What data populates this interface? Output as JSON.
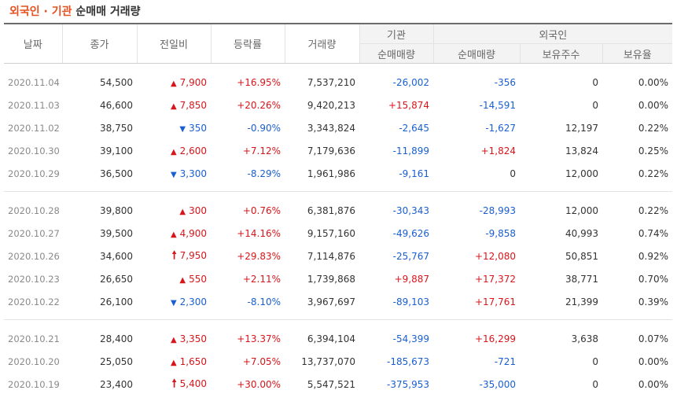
{
  "title": {
    "part1": "외국인",
    "sep": " · ",
    "part2": "기관",
    "part3": "순매매 거래량"
  },
  "colors": {
    "up": "#d8151b",
    "down": "#1a5fd1",
    "title_accent": "#e6501e"
  },
  "columns": {
    "date": "날짜",
    "close": "종가",
    "change": "전일비",
    "rate": "등락률",
    "volume": "거래량",
    "inst_group": "기관",
    "inst_net": "순매매량",
    "foreign_group": "외국인",
    "foreign_net": "순매매량",
    "foreign_hold": "보유주수",
    "foreign_ratio": "보유율"
  },
  "groups": [
    [
      {
        "date": "2020.11.04",
        "close": "54,500",
        "dir": "up",
        "arrow": "▲",
        "change": "7,900",
        "rate": "+16.95%",
        "volume": "7,537,210",
        "inst": "-26,002",
        "foreign": "-356",
        "hold": "0",
        "ratio": "0.00%"
      },
      {
        "date": "2020.11.03",
        "close": "46,600",
        "dir": "up",
        "arrow": "▲",
        "change": "7,850",
        "rate": "+20.26%",
        "volume": "9,420,213",
        "inst": "+15,874",
        "foreign": "-14,591",
        "hold": "0",
        "ratio": "0.00%"
      },
      {
        "date": "2020.11.02",
        "close": "38,750",
        "dir": "down",
        "arrow": "▼",
        "change": "350",
        "rate": "-0.90%",
        "volume": "3,343,824",
        "inst": "-2,645",
        "foreign": "-1,627",
        "hold": "12,197",
        "ratio": "0.22%"
      },
      {
        "date": "2020.10.30",
        "close": "39,100",
        "dir": "up",
        "arrow": "▲",
        "change": "2,600",
        "rate": "+7.12%",
        "volume": "7,179,636",
        "inst": "-11,899",
        "foreign": "+1,824",
        "hold": "13,824",
        "ratio": "0.25%"
      },
      {
        "date": "2020.10.29",
        "close": "36,500",
        "dir": "down",
        "arrow": "▼",
        "change": "3,300",
        "rate": "-8.29%",
        "volume": "1,961,986",
        "inst": "-9,161",
        "foreign": "0",
        "hold": "12,000",
        "ratio": "0.22%"
      }
    ],
    [
      {
        "date": "2020.10.28",
        "close": "39,800",
        "dir": "up",
        "arrow": "▲",
        "change": "300",
        "rate": "+0.76%",
        "volume": "6,381,876",
        "inst": "-30,343",
        "foreign": "-28,993",
        "hold": "12,000",
        "ratio": "0.22%"
      },
      {
        "date": "2020.10.27",
        "close": "39,500",
        "dir": "up",
        "arrow": "▲",
        "change": "4,900",
        "rate": "+14.16%",
        "volume": "9,157,160",
        "inst": "-49,626",
        "foreign": "-9,858",
        "hold": "40,993",
        "ratio": "0.74%"
      },
      {
        "date": "2020.10.26",
        "close": "34,600",
        "dir": "up",
        "arrow": "🠕",
        "arrow_type": "limit",
        "change": "7,950",
        "rate": "+29.83%",
        "volume": "7,114,876",
        "inst": "-25,767",
        "foreign": "+12,080",
        "hold": "50,851",
        "ratio": "0.92%"
      },
      {
        "date": "2020.10.23",
        "close": "26,650",
        "dir": "up",
        "arrow": "▲",
        "change": "550",
        "rate": "+2.11%",
        "volume": "1,739,868",
        "inst": "+9,887",
        "foreign": "+17,372",
        "hold": "38,771",
        "ratio": "0.70%"
      },
      {
        "date": "2020.10.22",
        "close": "26,100",
        "dir": "down",
        "arrow": "▼",
        "change": "2,300",
        "rate": "-8.10%",
        "volume": "3,967,697",
        "inst": "-89,103",
        "foreign": "+17,761",
        "hold": "21,399",
        "ratio": "0.39%"
      }
    ],
    [
      {
        "date": "2020.10.21",
        "close": "28,400",
        "dir": "up",
        "arrow": "▲",
        "change": "3,350",
        "rate": "+13.37%",
        "volume": "6,394,104",
        "inst": "-54,399",
        "foreign": "+16,299",
        "hold": "3,638",
        "ratio": "0.07%"
      },
      {
        "date": "2020.10.20",
        "close": "25,050",
        "dir": "up",
        "arrow": "▲",
        "change": "1,650",
        "rate": "+7.05%",
        "volume": "13,737,070",
        "inst": "-185,673",
        "foreign": "-721",
        "hold": "0",
        "ratio": "0.00%"
      },
      {
        "date": "2020.10.19",
        "close": "23,400",
        "dir": "up",
        "arrow": "🠕",
        "arrow_type": "limit",
        "change": "5,400",
        "rate": "+30.00%",
        "volume": "5,547,521",
        "inst": "-375,953",
        "foreign": "-35,000",
        "hold": "0",
        "ratio": "0.00%"
      }
    ]
  ]
}
